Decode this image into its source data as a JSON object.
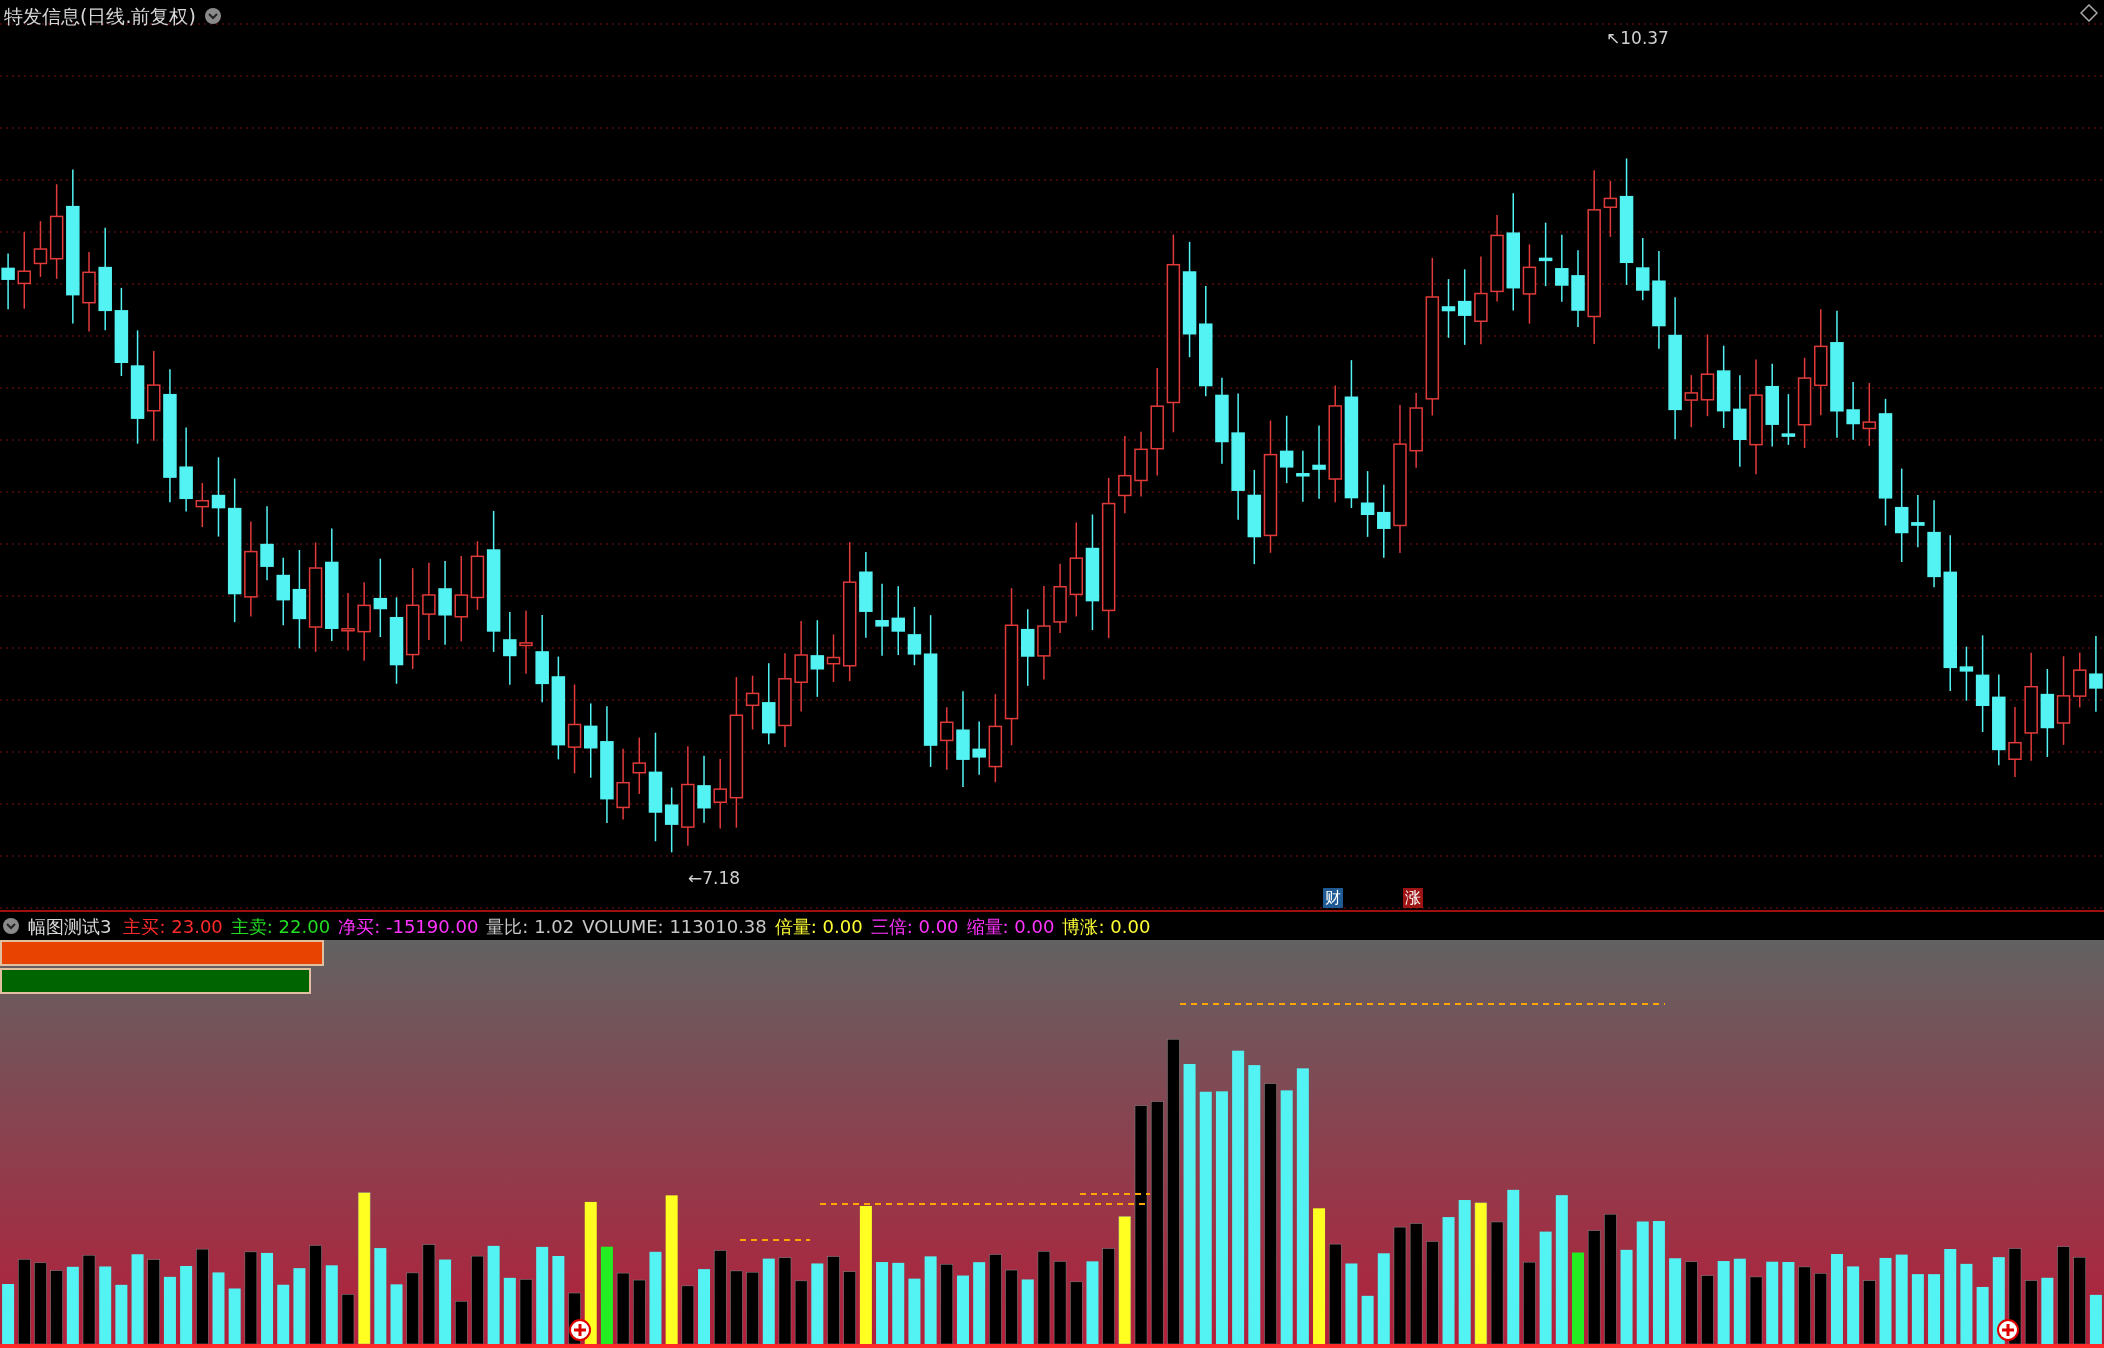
{
  "chart": {
    "title": "特发信息(日线.前复权)",
    "high_label": "↖10.37",
    "low_label": "←7.18",
    "badges": [
      {
        "text": "财",
        "color": "#1f5a94"
      },
      {
        "text": "涨",
        "color": "#9c1414"
      }
    ]
  },
  "indicator": {
    "name": "幅图测试3",
    "items": [
      {
        "label": "主买:",
        "value": "23.00",
        "kind": "buy"
      },
      {
        "label": "主卖:",
        "value": "22.00",
        "kind": "sell"
      },
      {
        "label": "净买:",
        "value": "-15190.00",
        "kind": "signal"
      },
      {
        "label": "量比:",
        "value": "1.02",
        "kind": "plain"
      },
      {
        "label": "VOLUME:",
        "value": "113010.38",
        "kind": "plain"
      },
      {
        "label": "倍量:",
        "value": "0.00",
        "kind": "alert"
      },
      {
        "label": "三倍:",
        "value": "0.00",
        "kind": "signal"
      },
      {
        "label": "缩量:",
        "value": "0.00",
        "kind": "signal"
      },
      {
        "label": "博涨:",
        "value": "0.00",
        "kind": "alert"
      }
    ],
    "bars": [
      {
        "color": "#e84300",
        "level": 0.154
      },
      {
        "color": "#006400",
        "level": 0.148
      }
    ]
  }
}
